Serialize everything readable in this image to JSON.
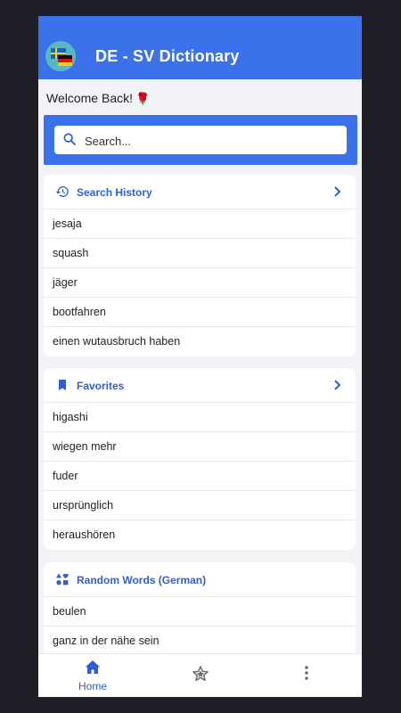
{
  "app": {
    "title": "DE - SV Dictionary"
  },
  "welcome": {
    "text": "Welcome Back!",
    "emoji": "🌹"
  },
  "search": {
    "placeholder": "Search..."
  },
  "history": {
    "title": "Search History",
    "items": [
      "jesaja",
      "squash",
      "jäger",
      "bootfahren",
      "einen wutausbruch haben"
    ]
  },
  "favorites": {
    "title": "Favorites",
    "items": [
      "higashi",
      "wiegen mehr",
      "fuder",
      "ursprünglich",
      "heraushören"
    ]
  },
  "random": {
    "title": "Random Words (German)",
    "items": [
      "beulen",
      "ganz in der nähe sein"
    ]
  },
  "nav": {
    "home_label": "Home"
  },
  "colors": {
    "primary": "#3b72ea",
    "accent_text": "#2f5fcc",
    "background": "#f2f3f6"
  },
  "icons": [
    "history-icon",
    "bookmark-icon",
    "shapes-icon",
    "chevron-right-icon",
    "search-icon",
    "home-icon",
    "star-outline-icon",
    "more-vertical-icon"
  ]
}
